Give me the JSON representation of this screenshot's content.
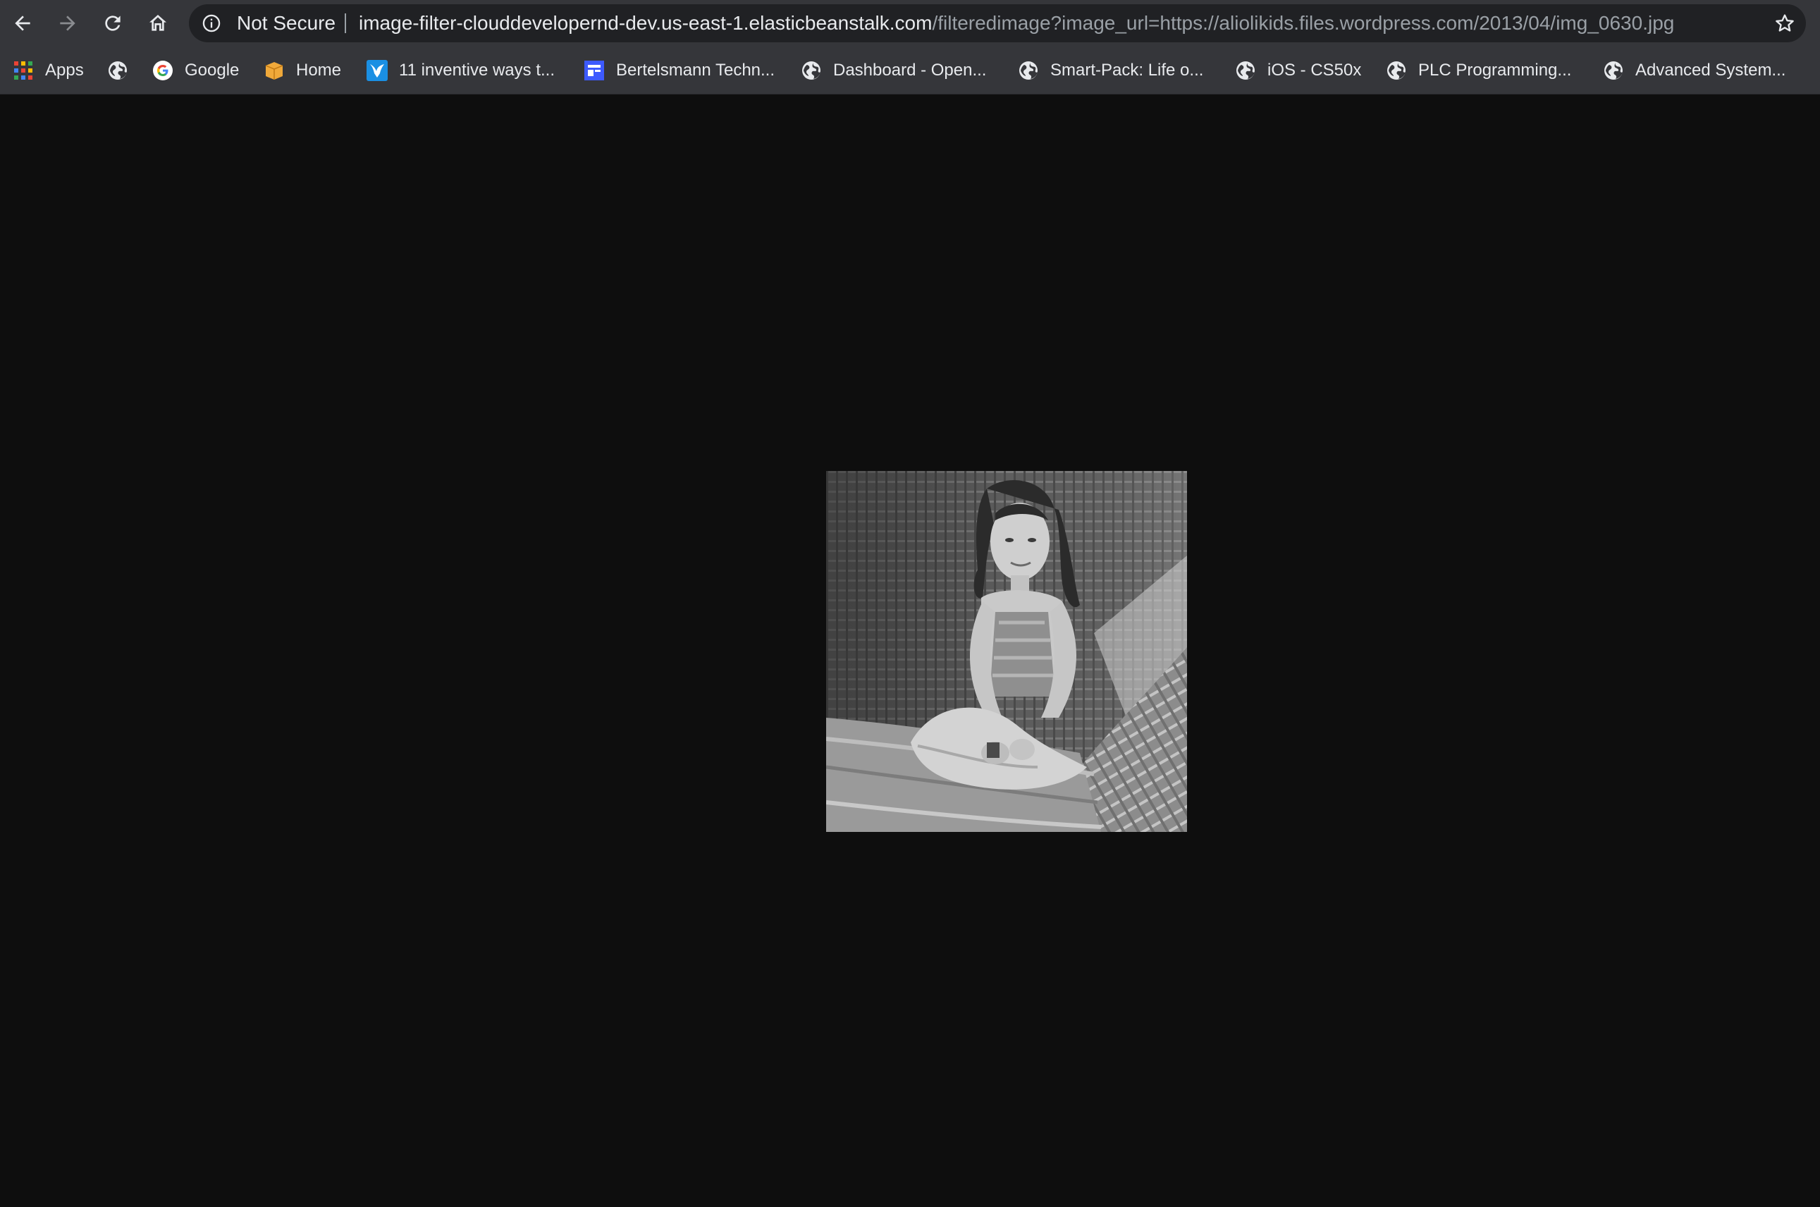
{
  "toolbar": {
    "security_label": "Not Secure",
    "url_host": "image-filter-clouddevelopernd-dev.us-east-1.elasticbeanstalk.com",
    "url_path": "/filteredimage?image_url=https://aliolikids.files.wordpress.com/2013/04/img_0630.jpg",
    "icons": [
      "back-arrow-icon",
      "forward-arrow-icon",
      "reload-icon",
      "home-icon",
      "info-icon",
      "star-icon"
    ]
  },
  "bookmarks": {
    "items": [
      {
        "label": "Apps",
        "icon": "apps-grid-icon"
      },
      {
        "label": "",
        "icon": "globe-icon"
      },
      {
        "label": "Google",
        "icon": "google-icon"
      },
      {
        "label": "Home",
        "icon": "box-icon"
      },
      {
        "label": "11 inventive ways t...",
        "icon": "bird-icon"
      },
      {
        "label": "Bertelsmann Techn...",
        "icon": "window-icon"
      },
      {
        "label": "Dashboard - Open...",
        "icon": "globe-icon"
      },
      {
        "label": "Smart-Pack: Life o...",
        "icon": "globe-icon"
      },
      {
        "label": "iOS - CS50x",
        "icon": "globe-icon"
      },
      {
        "label": "PLC Programming...",
        "icon": "globe-icon"
      },
      {
        "label": "Advanced System...",
        "icon": "globe-icon"
      }
    ]
  },
  "content": {
    "image_style": "grayscale"
  },
  "colors": {
    "toolbar_bg": "#35363a",
    "omnibox_bg": "#202124",
    "page_bg": "#0e0e0e",
    "text": "#e8eaed",
    "muted_text": "#9aa0a6"
  }
}
